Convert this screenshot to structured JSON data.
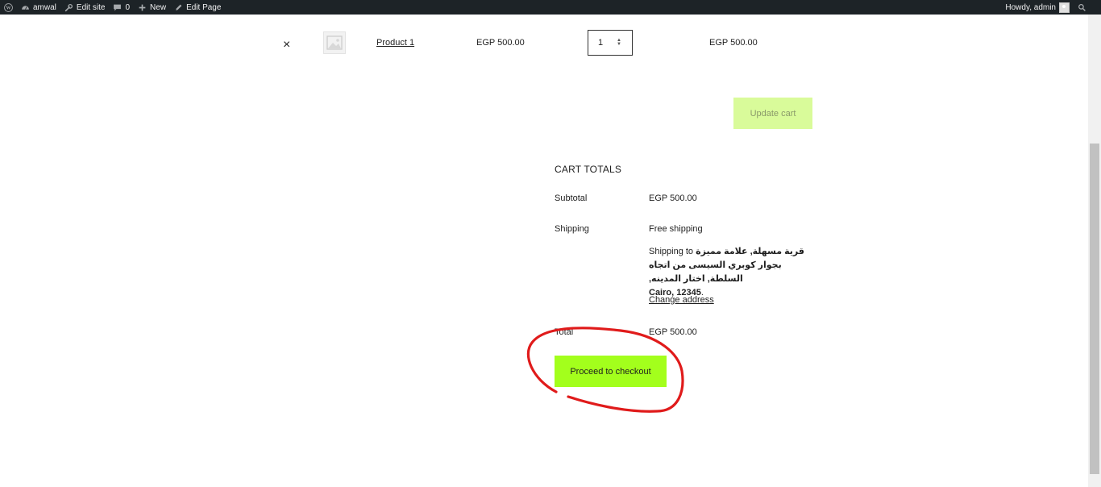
{
  "adminbar": {
    "site_name": "amwal",
    "edit_site": "Edit site",
    "comments_count": "0",
    "new_label": "New",
    "edit_page": "Edit Page",
    "howdy": "Howdy, admin"
  },
  "cart": {
    "remove_symbol": "×",
    "product_name": "Product 1",
    "price": "EGP 500.00",
    "quantity": "1",
    "line_total": "EGP 500.00",
    "update_cart_label": "Update cart"
  },
  "totals": {
    "title": "CART TOTALS",
    "subtotal_label": "Subtotal",
    "subtotal_value": "EGP 500.00",
    "shipping_label": "Shipping",
    "shipping_method": "Free shipping",
    "shipping_to_prefix": "Shipping to",
    "shipping_address_line": "قرية مسهلة, علامة مميزة بجوار كوبري السيسى من اتجاه السلطة, اختار المدينه,",
    "shipping_city": "Cairo, 12345",
    "change_address": "Change address",
    "total_label": "Total",
    "total_value": "EGP 500.00",
    "checkout_label": "Proceed to checkout"
  },
  "colors": {
    "adminbar_bg": "#1d2327",
    "checkout_bg": "#a3ff1c",
    "update_cart_bg": "#d9fb9a",
    "annotation": "#e01b1b"
  },
  "icons": [
    "wordpress-icon",
    "dashboard-icon",
    "wrench-icon",
    "comment-icon",
    "plus-icon",
    "pencil-icon",
    "search-icon",
    "image-placeholder-icon"
  ]
}
